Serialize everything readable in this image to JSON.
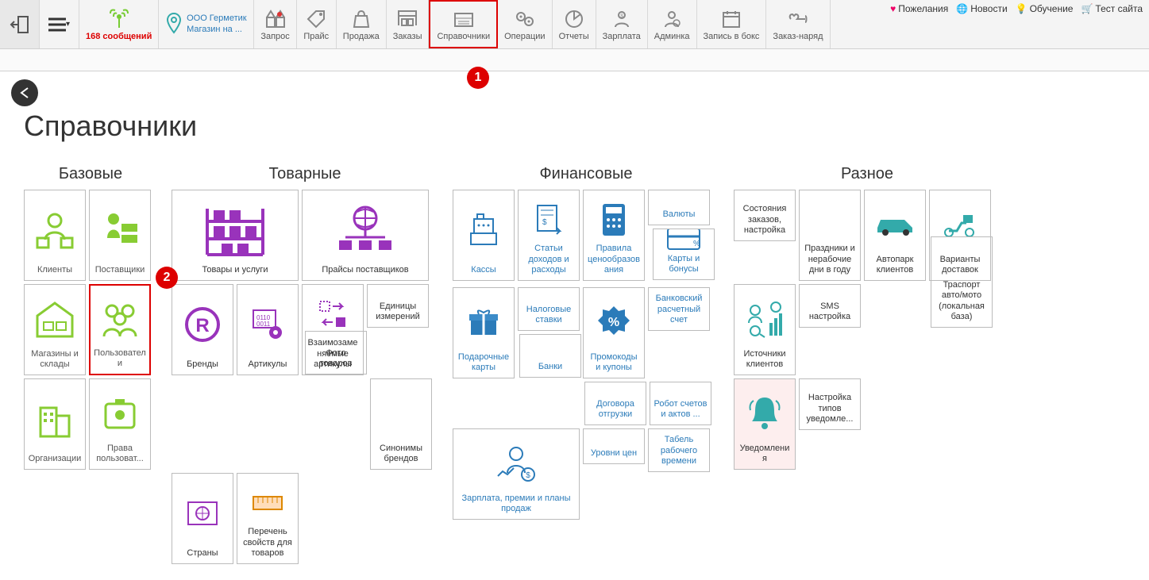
{
  "toolbar": {
    "messages": "168 сообщений",
    "org_line1": "ООО Герметик",
    "org_line2": "Магазин на ...",
    "items": [
      {
        "id": "zapros",
        "label": "Запрос"
      },
      {
        "id": "price",
        "label": "Прайс"
      },
      {
        "id": "sale",
        "label": "Продажа"
      },
      {
        "id": "orders",
        "label": "Заказы"
      },
      {
        "id": "refs",
        "label": "Справочники"
      },
      {
        "id": "ops",
        "label": "Операции"
      },
      {
        "id": "reports",
        "label": "Отчеты"
      },
      {
        "id": "salary",
        "label": "Зарплата"
      },
      {
        "id": "admin",
        "label": "Админка"
      },
      {
        "id": "booking",
        "label": "Запись в бокс"
      },
      {
        "id": "workorder",
        "label": "Заказ-наряд"
      }
    ]
  },
  "top_right": {
    "wishes": "Пожелания",
    "news": "Новости",
    "learn": "Обучение",
    "test": "Тест сайта"
  },
  "page": {
    "title": "Справочники"
  },
  "groups": {
    "base": {
      "title": "Базовые",
      "tiles": [
        {
          "label": "Клиенты"
        },
        {
          "label": "Поставщики"
        },
        {
          "label": "Магазины и склады"
        },
        {
          "label": "Пользователи"
        },
        {
          "label": "Организации"
        },
        {
          "label": "Права пользоват..."
        }
      ]
    },
    "goods": {
      "title": "Товарные",
      "tiles": [
        {
          "label": "Товары и услуги"
        },
        {
          "label": "Прайсы поставщиков"
        },
        {
          "label": "Бренды"
        },
        {
          "label": "Артикулы"
        },
        {
          "label": "Взаимозаменяемые артикулы"
        },
        {
          "label": "Единицы измерений"
        },
        {
          "label": "Фото товаров"
        },
        {
          "label": "Синонимы брендов"
        },
        {
          "label": "Страны"
        },
        {
          "label": "Перечень свойств для товаров"
        }
      ]
    },
    "fin": {
      "title": "Финансовые",
      "tiles": [
        {
          "label": "Кассы"
        },
        {
          "label": "Статьи доходов и расходы"
        },
        {
          "label": "Правила ценообразования"
        },
        {
          "label": "Валюты"
        },
        {
          "label": "Подарочные карты"
        },
        {
          "label": "Налоговые ставки"
        },
        {
          "label": "Промокоды и купоны"
        },
        {
          "label": "Карты и бонусы"
        },
        {
          "label": "Договора отгрузки"
        },
        {
          "label": "Банки"
        },
        {
          "label": "Робот счетов и актов ..."
        },
        {
          "label": "Банковский расчетный счет"
        },
        {
          "label": "Уровни цен"
        },
        {
          "label": "Табель рабочего времени"
        },
        {
          "label": "Зарплата, премии и планы продаж"
        }
      ]
    },
    "misc": {
      "title": "Разное",
      "tiles": [
        {
          "label": "Состояния заказов, настройка"
        },
        {
          "label": "Праздники и нерабочие дни в году"
        },
        {
          "label": "Автопарк клиентов"
        },
        {
          "label": "Варианты доставок"
        },
        {
          "label": "Источники клиентов"
        },
        {
          "label": "SMS настройка"
        },
        {
          "label": "Уведомления"
        },
        {
          "label": "Траспорт авто/мото (локальная база)"
        },
        {
          "label": "Настройка типов уведомле..."
        }
      ]
    }
  },
  "markers": {
    "m1": "1",
    "m2": "2"
  }
}
